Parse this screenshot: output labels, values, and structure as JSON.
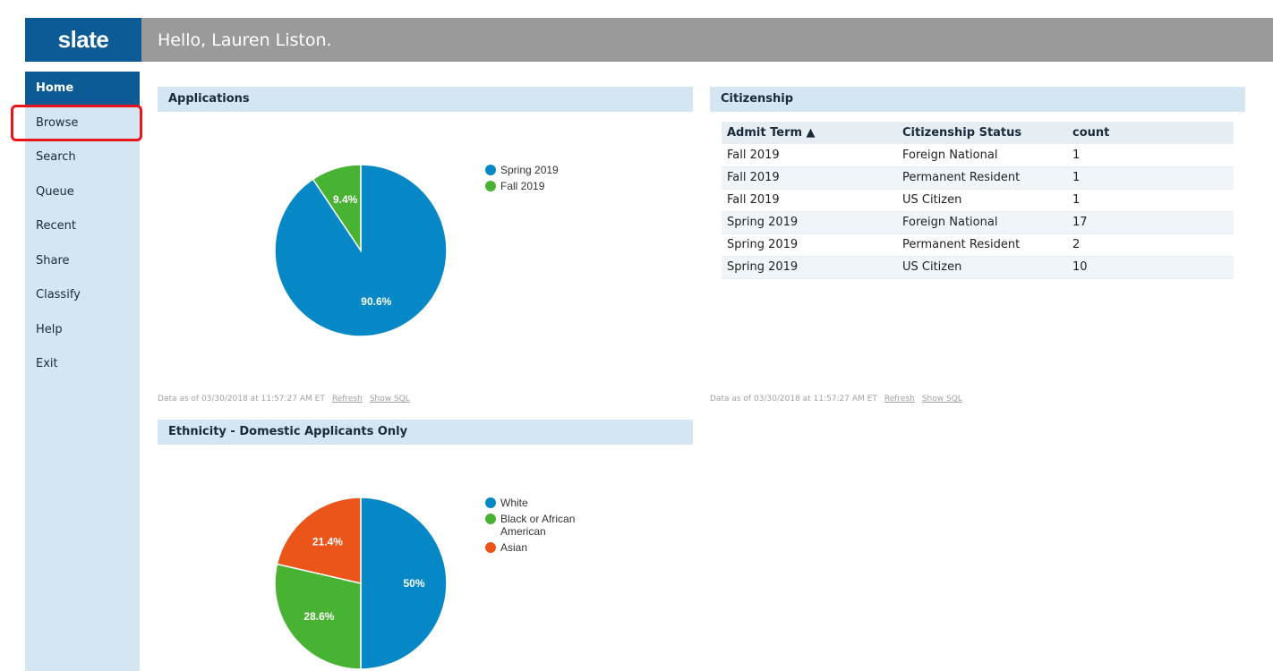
{
  "app": {
    "logo": "slate",
    "greeting": "Hello, Lauren Liston."
  },
  "sidebar": {
    "items": [
      {
        "label": "Home",
        "active": true
      },
      {
        "label": "Browse",
        "active": false
      },
      {
        "label": "Search",
        "active": false
      },
      {
        "label": "Queue",
        "active": false
      },
      {
        "label": "Recent",
        "active": false
      },
      {
        "label": "Share",
        "active": false
      },
      {
        "label": "Classify",
        "active": false
      },
      {
        "label": "Help",
        "active": false
      },
      {
        "label": "Exit",
        "active": false
      }
    ],
    "highlighted_item": "Browse",
    "highlight_color": "#e8141b"
  },
  "colors": {
    "brand": "#0c5b95",
    "header_gray": "#9a9a9a",
    "panel_bg": "#d4e6f1",
    "blue": "#0788c6",
    "green": "#48b232",
    "orange": "#ec5519"
  },
  "applications": {
    "title": "Applications",
    "data_note": "Data as of 03/30/2018 at 11:57:27 AM ET",
    "refresh": "Refresh",
    "show_sql": "Show SQL"
  },
  "citizenship": {
    "title": "Citizenship",
    "columns": [
      "Admit Term ▲",
      "Citizenship Status",
      "count"
    ],
    "rows": [
      [
        "Fall 2019",
        "Foreign National",
        "1"
      ],
      [
        "Fall 2019",
        "Permanent Resident",
        "1"
      ],
      [
        "Fall 2019",
        "US Citizen",
        "1"
      ],
      [
        "Spring 2019",
        "Foreign National",
        "17"
      ],
      [
        "Spring 2019",
        "Permanent Resident",
        "2"
      ],
      [
        "Spring 2019",
        "US Citizen",
        "10"
      ]
    ],
    "data_note": "Data as of 03/30/2018 at 11:57:27 AM ET",
    "refresh": "Refresh",
    "show_sql": "Show SQL"
  },
  "ethnicity": {
    "title": "Ethnicity - Domestic Applicants Only"
  },
  "chart_data": [
    {
      "type": "pie",
      "title": "Applications",
      "categories": [
        "Spring 2019",
        "Fall 2019"
      ],
      "values": [
        90.6,
        9.4
      ],
      "labels": [
        "90.6%",
        "9.4%"
      ],
      "colors": [
        "#0788c6",
        "#48b232"
      ],
      "legend": "right"
    },
    {
      "type": "pie",
      "title": "Ethnicity - Domestic Applicants Only",
      "categories": [
        "White",
        "Black or African American",
        "Asian"
      ],
      "values": [
        50,
        28.6,
        21.4
      ],
      "labels": [
        "50%",
        "28.6%",
        "21.4%"
      ],
      "colors": [
        "#0788c6",
        "#48b232",
        "#ec5519"
      ],
      "legend": "right"
    }
  ]
}
